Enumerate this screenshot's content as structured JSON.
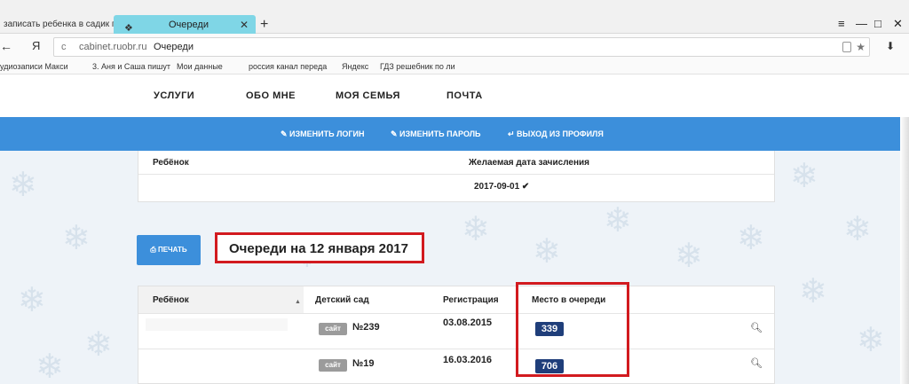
{
  "browser": {
    "tabs": [
      {
        "title": "записать ребенка в садик п"
      },
      {
        "title": "Очереди",
        "favicon": "bird-icon"
      }
    ],
    "new_tab": "+",
    "controls": {
      "menu": "≡",
      "minimize": "—",
      "maximize": "□",
      "close": "✕"
    }
  },
  "address_bar": {
    "back": "←",
    "ya": "Я",
    "reload": "c",
    "domain": "cabinet.ruobr.ru",
    "page": "Очереди"
  },
  "bookmarks": [
    "удиозаписи Макси",
    "3. Аня и Саша пишут",
    "Мои данные",
    "россия канал переда",
    "Яндекс",
    "ГДЗ решебник по ли"
  ],
  "nav": {
    "items": [
      "УСЛУГИ",
      "ОБО МНЕ",
      "МОЯ СЕМЬЯ",
      "ПОЧТА"
    ]
  },
  "profile_links": {
    "change_login": "ИЗМЕНИТЬ ЛОГИН",
    "change_password": "ИЗМЕНИТЬ ПАРОЛЬ",
    "logout": "ВЫХОД ИЗ ПРОФИЛЯ"
  },
  "enrollment_card": {
    "child_header": "Ребёнок",
    "date_header": "Желаемая дата зачисления",
    "date_value": "2017-09-01 ✔"
  },
  "print_button": "ПЕЧАТЬ",
  "queue_title": "Очереди на 12 января 2017",
  "queue_table": {
    "headers": {
      "child": "Ребёнок",
      "kindergarten": "Детский сад",
      "registration": "Регистрация",
      "place": "Место в очереди"
    },
    "rows": [
      {
        "site_label": "сайт",
        "number": "№239",
        "registration": "03.08.2015",
        "place": "339"
      },
      {
        "site_label": "сайт",
        "number": "№19",
        "registration": "16.03.2016",
        "place": "706"
      }
    ]
  },
  "colors": {
    "accent_blue": "#3c8fdb",
    "highlight_red": "#d21a1f",
    "badge_navy": "#1f3e7a",
    "active_tab": "#7fd6e6"
  }
}
